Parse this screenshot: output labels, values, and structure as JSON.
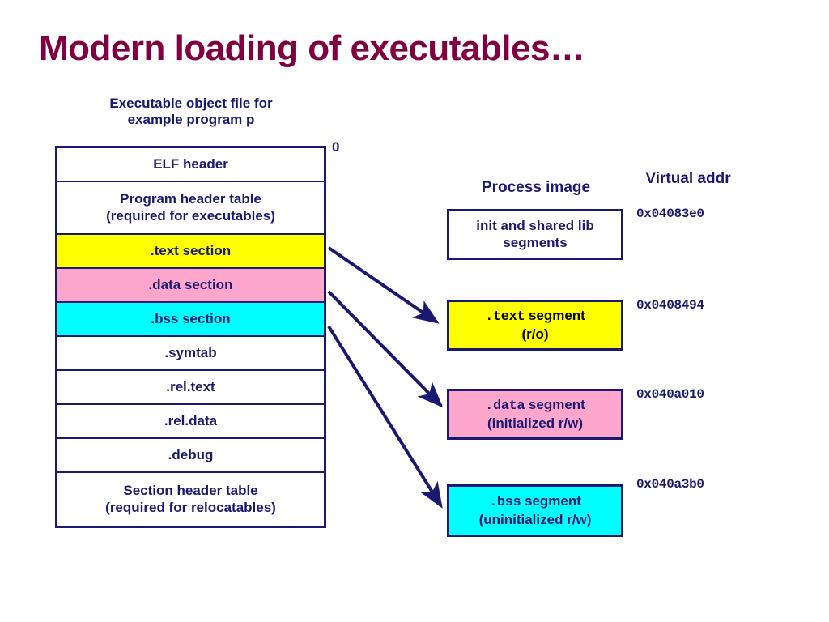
{
  "slide": {
    "title": "Modern loading of executables…"
  },
  "object_file": {
    "caption_line1": "Executable object file for",
    "caption_line2": "example program p",
    "offset_label": "0",
    "rows": [
      {
        "label": "ELF header",
        "label2": "",
        "fill": "white"
      },
      {
        "label": "Program header table",
        "label2": "(required for executables)",
        "fill": "white"
      },
      {
        "label": ".text section",
        "label2": "",
        "fill": "yellow"
      },
      {
        "label": ".data section",
        "label2": "",
        "fill": "pink"
      },
      {
        "label": ".bss section",
        "label2": "",
        "fill": "cyan"
      },
      {
        "label": ".symtab",
        "label2": "",
        "fill": "white"
      },
      {
        "label": ".rel.text",
        "label2": "",
        "fill": "white"
      },
      {
        "label": ".rel.data",
        "label2": "",
        "fill": "white"
      },
      {
        "label": ".debug",
        "label2": "",
        "fill": "white"
      },
      {
        "label": "Section header table",
        "label2": "(required for relocatables)",
        "fill": "white"
      }
    ]
  },
  "process_image": {
    "heading": "Process image",
    "virtual_addr_heading": "Virtual addr",
    "segments": [
      {
        "mono_name": "",
        "name": "init and shared lib",
        "detail": "segments",
        "vaddr": "0x04083e0",
        "fill": "white"
      },
      {
        "mono_name": ".text",
        "name": "segment",
        "detail": "(r/o)",
        "vaddr": "0x0408494",
        "fill": "yellow"
      },
      {
        "mono_name": ".data",
        "name": "segment",
        "detail": "(initialized r/w)",
        "vaddr": "0x040a010",
        "fill": "pink"
      },
      {
        "mono_name": ".bss",
        "name": "segment",
        "detail": "(uninitialized r/w)",
        "vaddr": "0x040a3b0",
        "fill": "cyan"
      }
    ]
  },
  "colors": {
    "title": "#800040",
    "text": "#191970",
    "border": "#191970",
    "yellow": "#ffff00",
    "pink": "#ffa6cd",
    "cyan": "#00ffff",
    "background": "#ffffff"
  },
  "arrows": [
    {
      "from": ".text section",
      "to": ".text segment"
    },
    {
      "from": ".data section",
      "to": ".data segment"
    },
    {
      "from": ".bss section",
      "to": ".bss segment"
    }
  ]
}
